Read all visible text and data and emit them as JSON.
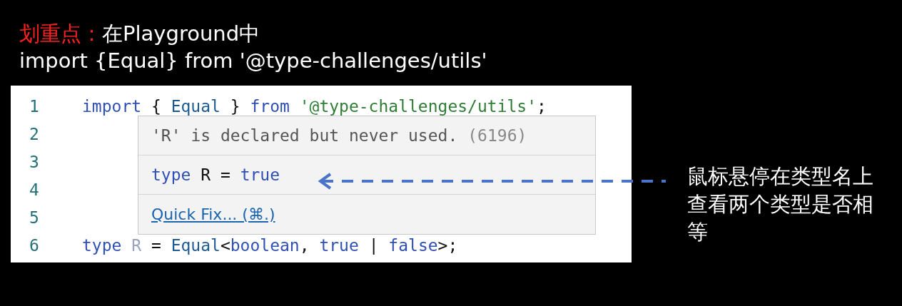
{
  "heading": {
    "highlight": "划重点：",
    "text": "在Playground中"
  },
  "subheading": "import {Equal} from '@type-challenges/utils'",
  "editor": {
    "lines": [
      {
        "number": "1",
        "tokens": [
          {
            "kind": "keyword",
            "text": "import"
          },
          {
            "kind": "plain",
            "text": " { "
          },
          {
            "kind": "type",
            "text": "Equal"
          },
          {
            "kind": "plain",
            "text": " } "
          },
          {
            "kind": "keyword",
            "text": "from "
          },
          {
            "kind": "string",
            "text": "'@type-challenges/utils'"
          },
          {
            "kind": "plain",
            "text": ";"
          }
        ]
      },
      {
        "number": "2"
      },
      {
        "number": "3"
      },
      {
        "number": "4"
      },
      {
        "number": "5"
      },
      {
        "number": "6",
        "tokens": [
          {
            "kind": "keyword",
            "text": "type "
          },
          {
            "kind": "unused",
            "text": "R"
          },
          {
            "kind": "plain",
            "text": " = "
          },
          {
            "kind": "type",
            "text": "Equal"
          },
          {
            "kind": "plain",
            "text": "<"
          },
          {
            "kind": "keyword",
            "text": "boolean"
          },
          {
            "kind": "plain",
            "text": ", "
          },
          {
            "kind": "keyword",
            "text": "true"
          },
          {
            "kind": "plain",
            "text": " | "
          },
          {
            "kind": "keyword",
            "text": "false"
          },
          {
            "kind": "plain",
            "text": ">;"
          }
        ]
      }
    ]
  },
  "tooltip": {
    "message": "'R' is declared but never used.",
    "code": "(6196)",
    "signature": [
      {
        "kind": "keyword",
        "text": "type"
      },
      {
        "kind": "plain",
        "text": " R = "
      },
      {
        "kind": "keyword",
        "text": "true"
      }
    ],
    "action": "Quick Fix... (⌘.)"
  },
  "annotation": "鼠标悬停在类型名上查看两个类型是否相等"
}
